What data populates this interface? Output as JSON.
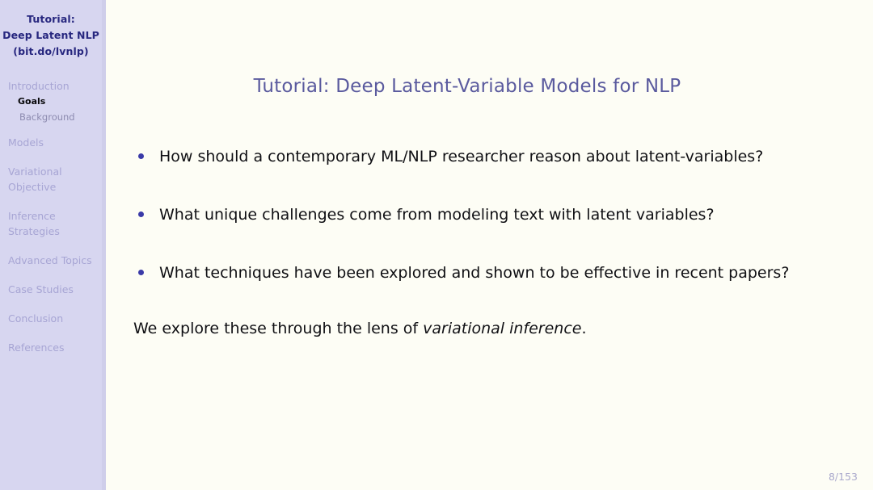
{
  "sidebar": {
    "header": {
      "line1": "Tutorial:",
      "line2": "Deep Latent NLP",
      "line3": "(bit.do/lvnlp)"
    },
    "nav": [
      {
        "label": "Introduction",
        "label2": "",
        "current": false
      },
      {
        "label": "Goals",
        "sub": true,
        "current": true
      },
      {
        "label": "Background",
        "sub": true,
        "current": false
      },
      {
        "label": "Models",
        "label2": "",
        "current": false
      },
      {
        "label": "Variational",
        "label2": "Objective",
        "current": false
      },
      {
        "label": "Inference",
        "label2": "Strategies",
        "current": false
      },
      {
        "label": "Advanced Topics",
        "label2": "",
        "current": false
      },
      {
        "label": "Case Studies",
        "label2": "",
        "current": false
      },
      {
        "label": "Conclusion",
        "label2": "",
        "current": false
      },
      {
        "label": "References",
        "label2": "",
        "current": false
      }
    ]
  },
  "main": {
    "title": "Tutorial: Deep Latent-Variable Models for NLP",
    "bullets": [
      "How should a contemporary ML/NLP researcher reason about latent-variables?",
      "What unique challenges come from modeling text with latent variables?",
      "What techniques have been explored and shown to be effective in recent papers?"
    ],
    "closing_prefix": "We explore these through the lens of ",
    "closing_emphasis": "variational inference",
    "closing_suffix": ".",
    "page_number": "8/153"
  },
  "colors": {
    "sidebar_bg": "#d7d6f0",
    "sidebar_edge": "#cfceea",
    "slide_bg": "#fdfdf5",
    "header_text": "#27277f",
    "nav_text": "#a7a5d4",
    "nav_current": "#08080a",
    "title_text": "#5a5a9e",
    "bullet_dot": "#3a3aa8",
    "body_text": "#101014",
    "page_number": "#aaa9cc"
  }
}
